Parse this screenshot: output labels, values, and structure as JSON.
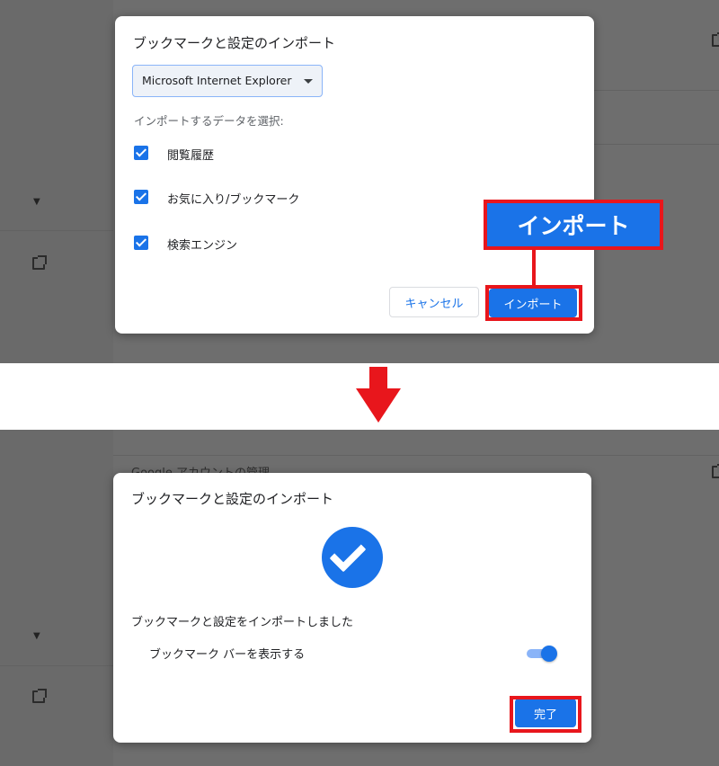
{
  "import_dialog": {
    "title": "ブックマークと設定のインポート",
    "browser_select": {
      "selected": "Microsoft Internet Explorer"
    },
    "section_label": "インポートするデータを選択:",
    "options": [
      {
        "label": "閲覧履歴",
        "checked": true
      },
      {
        "label": "お気に入り/ブックマーク",
        "checked": true
      },
      {
        "label": "検索エンジン",
        "checked": true
      }
    ],
    "cancel_label": "キャンセル",
    "import_label": "インポート"
  },
  "callout": {
    "text": "インポート"
  },
  "background": {
    "section_text": "Google アカウントの管理"
  },
  "done_dialog": {
    "title": "ブックマークと設定のインポート",
    "success_message": "ブックマークと設定をインポートしました",
    "toggle_label": "ブックマーク バーを表示する",
    "toggle_on": true,
    "done_label": "完了"
  },
  "colors": {
    "accent": "#1a73e8",
    "highlight_red": "#e8161c",
    "overlay": "#5f5f5f"
  },
  "icons": {
    "checkbox": "checkbox-checked-icon",
    "dropdown": "chevron-down-icon",
    "success": "check-circle-icon",
    "external_link": "open-in-new-icon",
    "arrow": "down-arrow-icon"
  }
}
